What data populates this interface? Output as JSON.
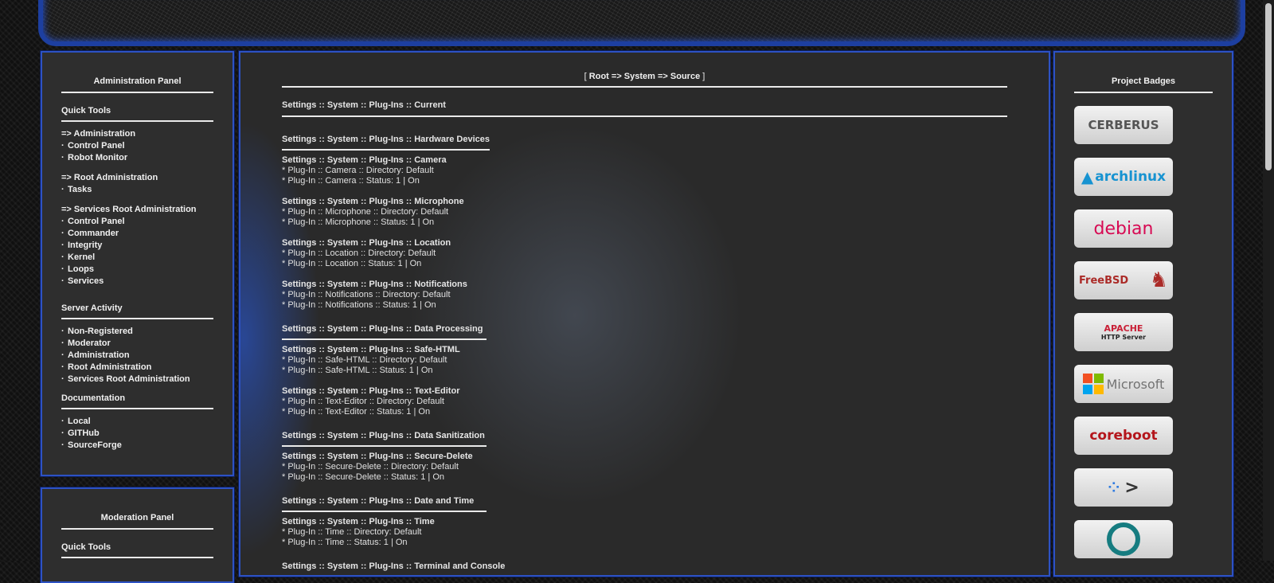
{
  "admin_panel": {
    "title": "Administration Panel",
    "quick_tools_label": "Quick Tools",
    "groups": [
      {
        "heading": "=> Administration",
        "items": [
          "Control Panel",
          "Robot Monitor"
        ]
      },
      {
        "heading": "=> Root Administration",
        "items": [
          "Tasks"
        ]
      },
      {
        "heading": "=> Services Root Administration",
        "items": [
          "Control Panel",
          "Commander",
          "Integrity",
          "Kernel",
          "Loops",
          "Services"
        ]
      }
    ],
    "server_activity_label": "Server Activity",
    "server_activity_items": [
      "Non-Registered",
      "Moderator",
      "Administration",
      "Root Administration",
      "Services Root Administration"
    ],
    "documentation_label": "Documentation",
    "documentation_items": [
      "Local",
      "GITHub",
      "SourceForge"
    ]
  },
  "moderation_panel": {
    "title": "Moderation Panel",
    "quick_tools_label": "Quick Tools"
  },
  "main": {
    "breadcrumb_open": "[",
    "breadcrumb_text": "Root => System => Source",
    "breadcrumb_close": "]",
    "current_heading": "Settings :: System :: Plug-Ins :: Current",
    "hardware_heading": "Settings :: System :: Plug-Ins :: Hardware Devices",
    "hardware_plugins": [
      {
        "title": "Settings :: System :: Plug-Ins :: Camera",
        "directory": "* Plug-In :: Camera :: Directory: Default",
        "status": "* Plug-In :: Camera :: Status: 1 | On"
      },
      {
        "title": "Settings :: System :: Plug-Ins :: Microphone",
        "directory": "* Plug-In :: Microphone :: Directory: Default",
        "status": "* Plug-In :: Microphone :: Status: 1 | On"
      },
      {
        "title": "Settings :: System :: Plug-Ins :: Location",
        "directory": "* Plug-In :: Location :: Directory: Default",
        "status": "* Plug-In :: Location :: Status: 1 | On"
      },
      {
        "title": "Settings :: System :: Plug-Ins :: Notifications",
        "directory": "* Plug-In :: Notifications :: Directory: Default",
        "status": "* Plug-In :: Notifications :: Status: 1 | On"
      }
    ],
    "data_processing_heading": "Settings :: System :: Plug-Ins :: Data Processing",
    "data_processing_plugins": [
      {
        "title": "Settings :: System :: Plug-Ins :: Safe-HTML",
        "directory": "* Plug-In :: Safe-HTML :: Directory: Default",
        "status": "* Plug-In :: Safe-HTML :: Status: 1 | On"
      },
      {
        "title": "Settings :: System :: Plug-Ins :: Text-Editor",
        "directory": "* Plug-In :: Text-Editor :: Directory: Default",
        "status": "* Plug-In :: Text-Editor :: Status: 1 | On"
      }
    ],
    "data_sanitization_heading": "Settings :: System :: Plug-Ins :: Data Sanitization",
    "data_sanitization_plugins": [
      {
        "title": "Settings :: System :: Plug-Ins :: Secure-Delete",
        "directory": "* Plug-In :: Secure-Delete :: Directory: Default",
        "status": "* Plug-In :: Secure-Delete :: Status: 1 | On"
      }
    ],
    "date_time_heading": "Settings :: System :: Plug-Ins :: Date and Time",
    "date_time_plugins": [
      {
        "title": "Settings :: System :: Plug-Ins :: Time",
        "directory": "* Plug-In :: Time :: Directory: Default",
        "status": "* Plug-In :: Time :: Status: 1 | On"
      }
    ],
    "terminal_heading": "Settings :: System :: Plug-Ins :: Terminal and Console"
  },
  "badges_panel": {
    "title": "Project Badges",
    "badges": [
      {
        "name": "cerberus-badge",
        "text": "CERBERUS",
        "color": "#555555"
      },
      {
        "name": "archlinux-badge",
        "text": "archlinux",
        "color": "#1793d1"
      },
      {
        "name": "debian-badge",
        "text": "debian",
        "color": "#d70a53"
      },
      {
        "name": "freebsd-badge",
        "text": "FreeBSD",
        "color": "#ab2b28"
      },
      {
        "name": "apache-badge",
        "text": "APACHE",
        "subtext": "HTTP Server",
        "color": "#c92037"
      },
      {
        "name": "microsoft-badge",
        "text": "Microsoft",
        "color": "#737373"
      },
      {
        "name": "coreboot-badge",
        "text": "coreboot",
        "color": "#b4151b"
      },
      {
        "name": "terminal-badge",
        "text": ">",
        "color": "#333333"
      },
      {
        "name": "lineage-badge",
        "text": "",
        "color": "#167c80"
      }
    ]
  }
}
